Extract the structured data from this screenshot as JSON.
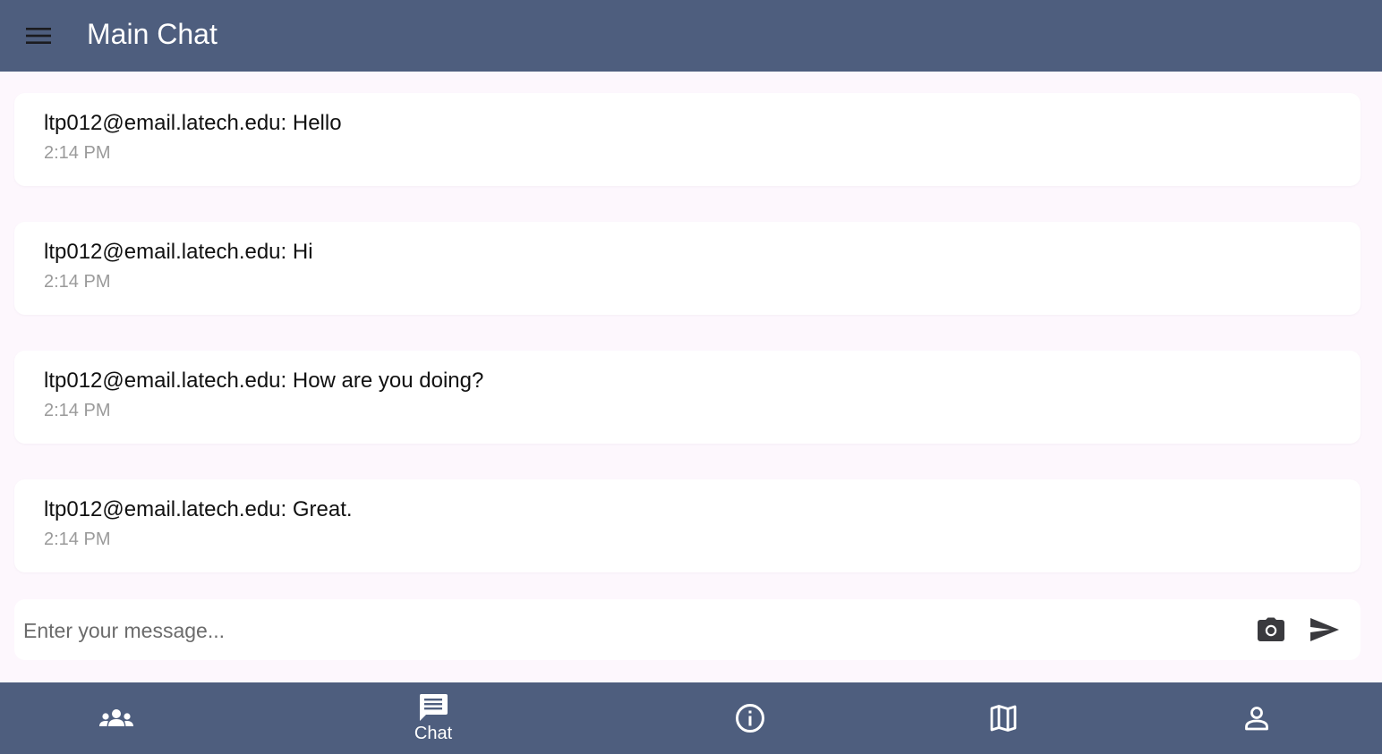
{
  "app_bar": {
    "title": "Main Chat",
    "menu_icon": "menu-icon"
  },
  "messages": [
    {
      "sender": "ltp012@email.latech.edu",
      "text": "Hello",
      "display": "ltp012@email.latech.edu: Hello",
      "time": "2:14 PM"
    },
    {
      "sender": "ltp012@email.latech.edu",
      "text": "Hi",
      "display": "ltp012@email.latech.edu: Hi",
      "time": "2:14 PM"
    },
    {
      "sender": "ltp012@email.latech.edu",
      "text": "How are you doing?",
      "display": "ltp012@email.latech.edu: How are you doing?",
      "time": "2:14 PM"
    },
    {
      "sender": "ltp012@email.latech.edu",
      "text": "Great.",
      "display": "ltp012@email.latech.edu: Great.",
      "time": "2:14 PM"
    }
  ],
  "composer": {
    "placeholder": "Enter your message...",
    "value": "",
    "camera_icon": "camera-icon",
    "send_icon": "send-icon"
  },
  "bottom_nav": {
    "items": [
      {
        "id": "groups",
        "icon": "groups-icon",
        "label": ""
      },
      {
        "id": "chat",
        "icon": "chat-icon",
        "label": "Chat",
        "selected": true
      },
      {
        "id": "info",
        "icon": "info-icon",
        "label": ""
      },
      {
        "id": "map",
        "icon": "map-icon",
        "label": ""
      },
      {
        "id": "profile",
        "icon": "person-icon",
        "label": ""
      }
    ]
  },
  "colors": {
    "bar_background": "#4e5e7e",
    "page_background": "#fdf7fd",
    "card_background": "#ffffff",
    "message_text": "#111111",
    "timestamp_text": "#9a9a9a"
  }
}
